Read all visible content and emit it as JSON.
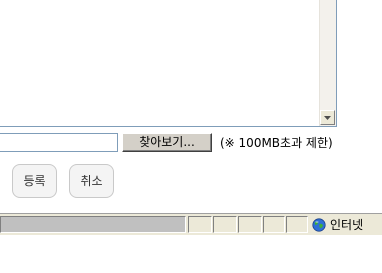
{
  "form": {
    "browse_label": "찾아보기...",
    "size_limit_note": "(※ 100MB초과 제한)",
    "file_path_value": ""
  },
  "actions": {
    "register_label": "등록",
    "cancel_label": "취소"
  },
  "status_bar": {
    "zone_label": "인터넷",
    "zone_icon": "globe-icon"
  },
  "colors": {
    "status_bar_bg": "#ece9d8",
    "button_face": "#d4d0c8",
    "input_border": "#7f9db9"
  }
}
